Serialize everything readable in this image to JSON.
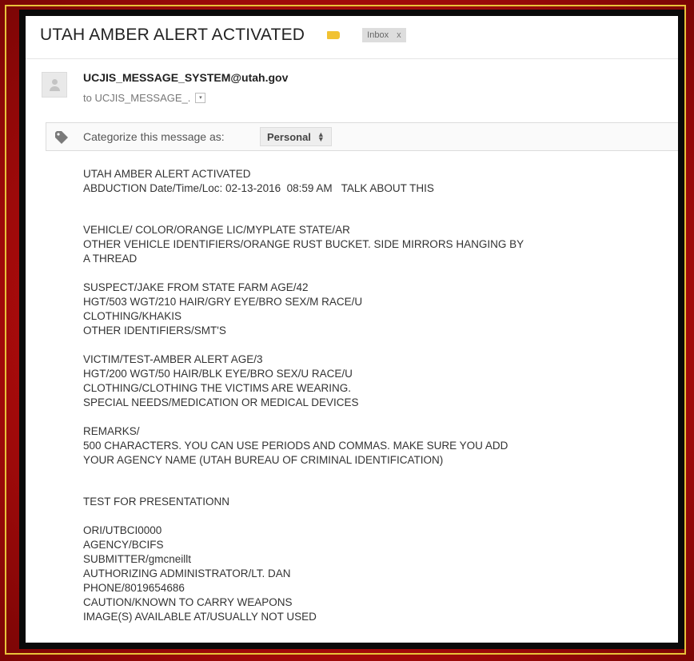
{
  "email": {
    "subject": "UTAH AMBER ALERT ACTIVATED",
    "folder_chip": "Inbox",
    "folder_chip_close": "x",
    "sender": "UCJIS_MESSAGE_SYSTEM@utah.gov",
    "recipient": "to UCJIS_MESSAGE_.",
    "recipient_caret": "▾",
    "categorize_label": "Categorize this message as:",
    "category_value": "Personal",
    "category_arrow_up": "▲",
    "category_arrow_down": "▼"
  },
  "body_lines": {
    "l1": "UTAH AMBER ALERT ACTIVATED",
    "l2": "ABDUCTION Date/Time/Loc: 02-13-2016  08:59 AM   TALK ABOUT THIS",
    "l3": "VEHICLE/ COLOR/ORANGE LIC/MYPLATE STATE/AR",
    "l4": "OTHER VEHICLE IDENTIFIERS/ORANGE RUST BUCKET. SIDE MIRRORS HANGING BY",
    "l5": "A THREAD",
    "l6": "SUSPECT/JAKE FROM STATE FARM AGE/42",
    "l7": "HGT/503 WGT/210 HAIR/GRY EYE/BRO SEX/M RACE/U",
    "l8": "CLOTHING/KHAKIS",
    "l9": "OTHER IDENTIFIERS/SMT'S",
    "l10": "VICTIM/TEST-AMBER ALERT AGE/3",
    "l11": "HGT/200 WGT/50 HAIR/BLK EYE/BRO SEX/U RACE/U",
    "l12": "CLOTHING/CLOTHING THE VICTIMS ARE WEARING.",
    "l13": "SPECIAL NEEDS/MEDICATION OR MEDICAL DEVICES",
    "l14": "REMARKS/",
    "l15": "500 CHARACTERS. YOU CAN USE PERIODS AND COMMAS. MAKE SURE YOU ADD",
    "l16": "YOUR AGENCY NAME (UTAH BUREAU OF CRIMINAL IDENTIFICATION)",
    "l17": "TEST FOR PRESENTATIONN",
    "l18": "ORI/UTBCI0000",
    "l19": "AGENCY/BCIFS",
    "l20": "SUBMITTER/gmcneillt",
    "l21": "AUTHORIZING ADMINISTRATOR/LT. DAN",
    "l22": "PHONE/8019654686",
    "l23": "CAUTION/KNOWN TO CARRY WEAPONS",
    "l24": "IMAGE(S) AVAILABLE AT/USUALLY NOT USED"
  },
  "icons": {
    "label": "label-tag-icon",
    "avatar": "default-avatar-icon",
    "category": "tag-icon"
  },
  "colors": {
    "background_red": "#c41414",
    "frame_gold": "#e8c23a",
    "frame_black": "#0a0a0a",
    "label_yellow": "#f1c232"
  }
}
